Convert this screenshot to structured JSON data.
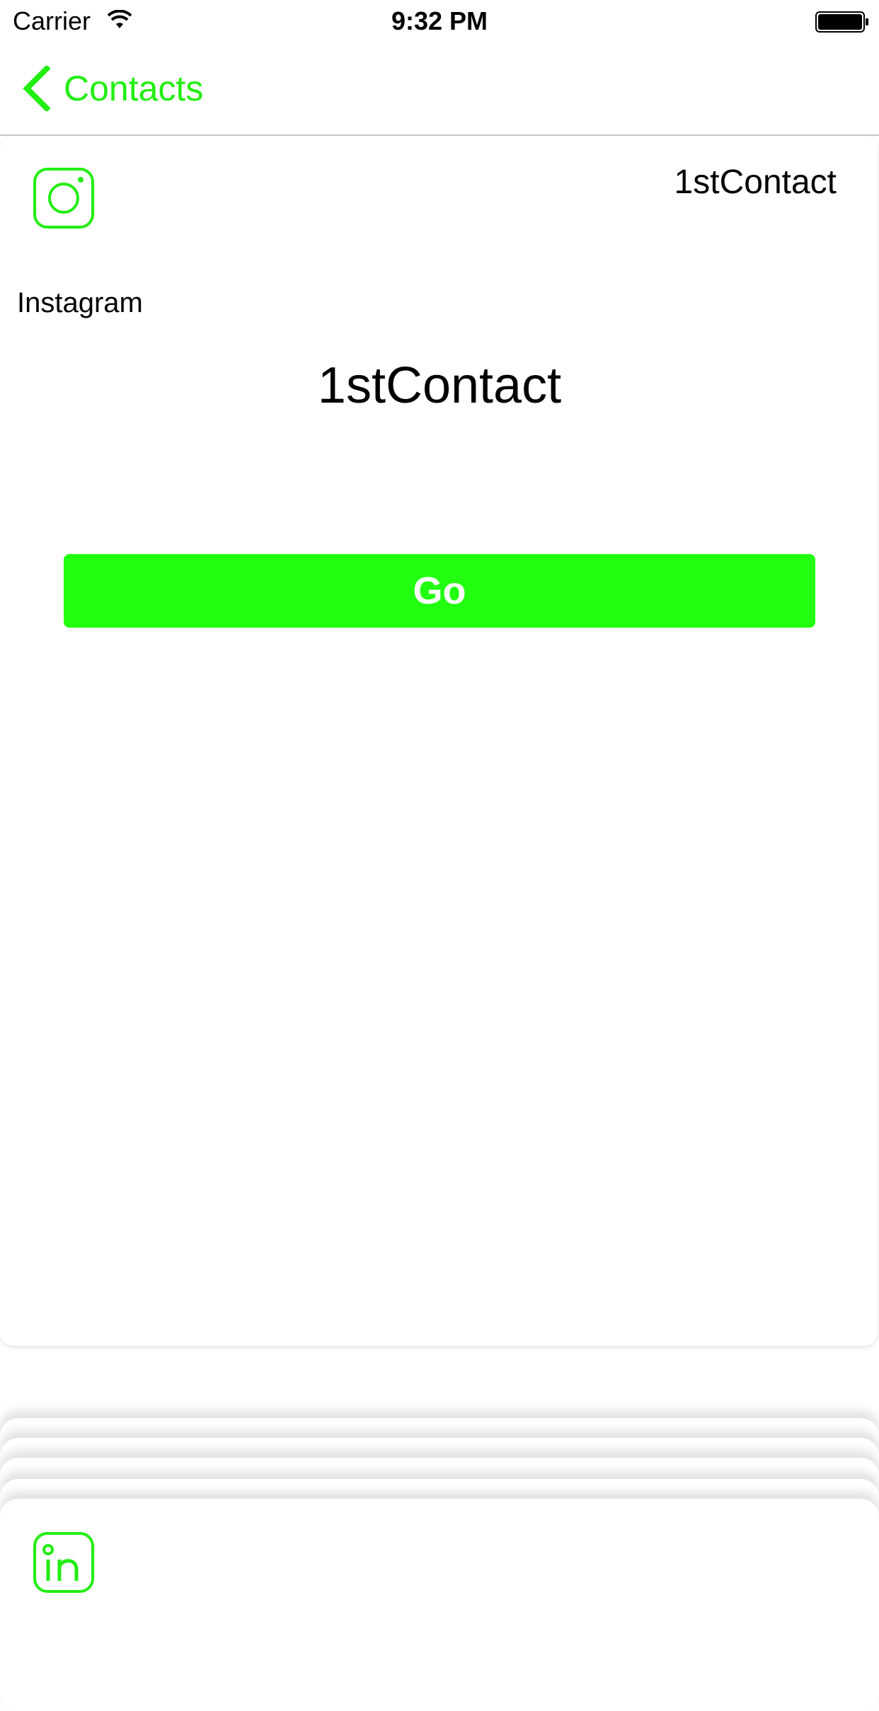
{
  "status_bar": {
    "carrier": "Carrier",
    "time": "9:32 PM"
  },
  "nav": {
    "back_label": "Contacts"
  },
  "card": {
    "header_name": "1stContact",
    "service": "Instagram",
    "contact_name": "1stContact",
    "button_label": "Go"
  },
  "colors": {
    "accent": "#22ee11",
    "button": "#22ff11"
  },
  "icons": {
    "service": "instagram-icon",
    "next_service": "linkedin-icon"
  }
}
